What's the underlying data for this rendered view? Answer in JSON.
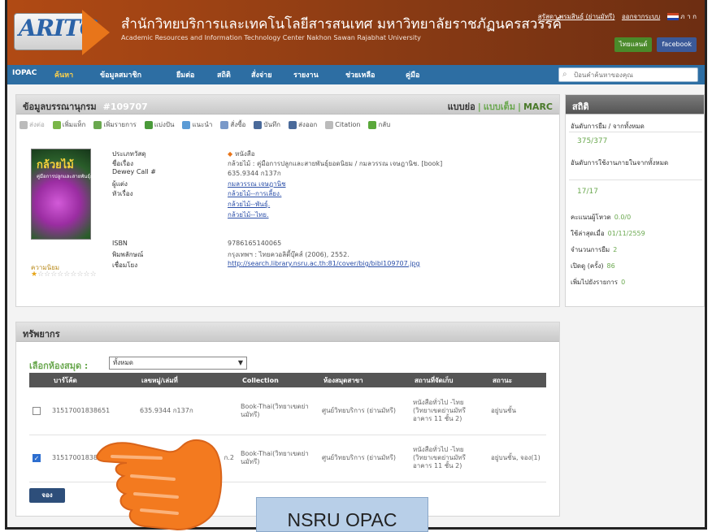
{
  "header": {
    "logo_text": "ARITC",
    "org_name_th": "สำนักวิทยบริการและเทคโนโลยีสารสนเทศ มหาวิทยาลัยราชภัฏนครสวรรค์",
    "org_name_en": "Academic Resources and Information Technology Center Nakhon Sawan Rajabhat University",
    "user_name": "สุรัสดา พรมสินธุ์ (ย่านมัทรี)",
    "logout_label": "ออกจากระบบ",
    "lang_label": "ภ า ก",
    "social_th": "ไทยแลนด์",
    "social_fb": "facebook"
  },
  "nav": {
    "items": [
      "IOPAC",
      "ค้นหา",
      "ข้อมูลสมาชิก",
      "ยืมต่อ",
      "สถิติ",
      "สั่งจ่าย",
      "รายงาน",
      "ช่วยเหลือ",
      "คู่มือ"
    ],
    "active_index": 1,
    "search_placeholder": "ป้อนคำค้นหาของคุณ"
  },
  "record": {
    "title": "ข้อมูลบรรณานุกรม",
    "bib_id": "#109707",
    "view_brief": "แบบย่อ",
    "view_full": "แบบเต็ม",
    "view_marc": "MARC",
    "toolbar": [
      "ส่งต่อ",
      "เพิ่มแท็ก",
      "เพิ่มรายการ",
      "แบ่งปัน",
      "แนะนำ",
      "สั่งซื้อ",
      "บันทึก",
      "ส่งออก",
      "Citation",
      "กลับ"
    ],
    "cover_title": "กล้วยไม้",
    "cover_subtitle": "คู่มือการปลูกและสายพันธุ์ยอดนิยม",
    "popularity_label": "ความนิยม",
    "fields": {
      "labels": [
        "ประเภทวัสดุ",
        "ชื่อเรื่อง",
        "Dewey Call #",
        "ผู้แต่ง",
        "หัวเรื่อง",
        "ISBN",
        "พิมพลักษณ์",
        "เชื่อมโยง"
      ],
      "material": "หนังสือ",
      "title": "กล้วยไม้ : คู่มือการปลูกและสายพันธุ์ยอดนิยม / กมลวรรณ เจษฎานิช. [book]",
      "call_no": "635.9344 ก137ก",
      "author": "กมลวรรณ เจษฎานิช",
      "subjects": [
        "กล้วยไม้--การเลี้ยง.",
        "กล้วยไม้--พันธุ์.",
        "กล้วยไม้--ไทย."
      ],
      "isbn": "9786165140065",
      "imprint": "กรุงเทพฯ : ไทยควอลิตี้บุ๊คส์ (2006), 2552.",
      "link": "http://search.library.nsru.ac.th:81/cover/big/bibl109707.jpg"
    }
  },
  "stats": {
    "title": "สถิติ",
    "rows": [
      {
        "label": "อันดับการยืม / จากทั้งหมด",
        "value": "375/377"
      },
      {
        "label": "อันดับการใช้งานภายในจากทั้งหมด",
        "value": "17/17"
      },
      {
        "label": "คะแนนผู้โหวต",
        "value": "0.0/0"
      },
      {
        "label": "ใช้ล่าสุดเมื่อ",
        "value": "01/11/2559"
      },
      {
        "label": "จำนวนการยืม",
        "value": "2"
      },
      {
        "label": "เปิดดู (ครั้ง)",
        "value": "86"
      },
      {
        "label": "เพิ่มไปยังรายการ",
        "value": "0"
      }
    ]
  },
  "resources": {
    "title": "ทรัพยากร",
    "branch_label": "เลือกห้องสมุด :",
    "branch_value": "ทั้งหมด",
    "columns": [
      "บาร์โค้ด",
      "เลขหมู่/เล่มที่",
      "Collection",
      "ห้องสมุดสาขา",
      "สถานที่จัดเก็บ",
      "สถานะ"
    ],
    "rows": [
      {
        "checked": false,
        "barcode": "31517001838651",
        "call_no": "635.9344 ก137ก",
        "collection": "Book-Thai(วิทยาเขตย่านมัทรี)",
        "branch": "ศูนย์วิทยบริการ (ย่านมัทรี)",
        "location": "หนังสือทั่วไป -ไทย (วิทยาเขตย่านมัทรี อาคาร 11 ชั้น 2)",
        "status": "อยู่บนชั้น"
      },
      {
        "checked": true,
        "barcode": "31517001838",
        "call_no": "ก.2",
        "collection": "Book-Thai(วิทยาเขตย่านมัทรี)",
        "branch": "ศูนย์วิทยบริการ (ย่านมัทรี)",
        "location": "หนังสือทั่วไป -ไทย (วิทยาเขตย่านมัทรี อาคาร 11 ชั้น 2)",
        "status": "อยู่บนชั้น, จอง(1)"
      }
    ],
    "reserve_label": "จอง"
  },
  "caption": "NSRU OPAC"
}
